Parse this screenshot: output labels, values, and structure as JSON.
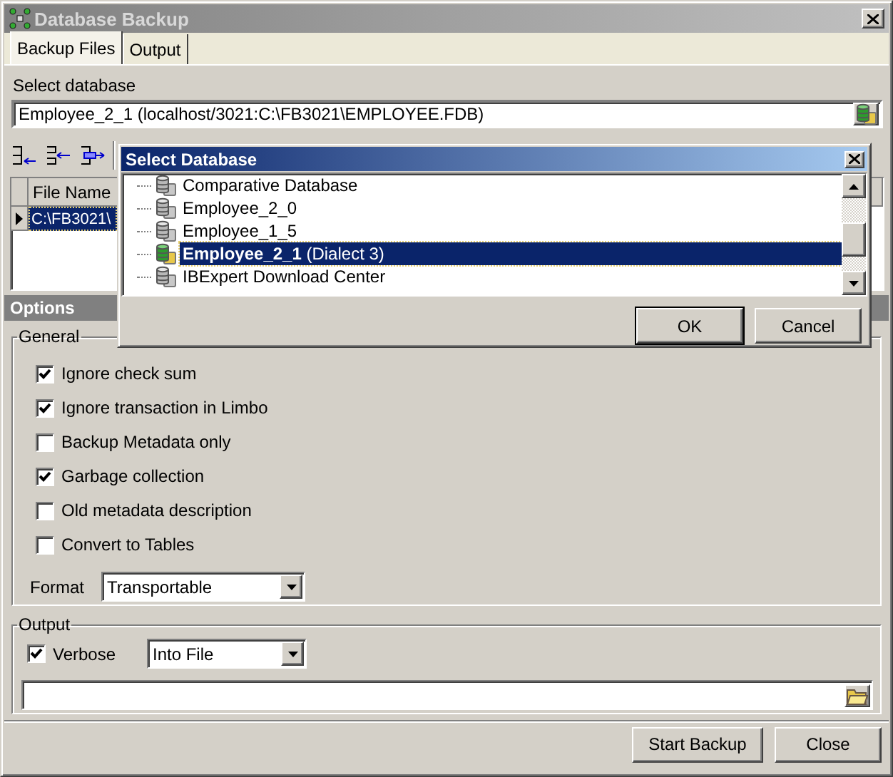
{
  "window": {
    "title": "Database Backup"
  },
  "tabs": [
    {
      "label": "Backup Files",
      "selected": true
    },
    {
      "label": "Output",
      "selected": false
    }
  ],
  "database": {
    "label": "Select database",
    "value": "Employee_2_1 (localhost/3021:C:\\FB3021\\EMPLOYEE.FDB)"
  },
  "files_grid": {
    "columns": [
      "File Name"
    ],
    "rows": [
      {
        "file_name": "C:\\FB3021\\",
        "selected": true
      }
    ]
  },
  "options": {
    "title": "Options",
    "general": {
      "title": "General",
      "checkboxes": [
        {
          "label": "Ignore check sum",
          "checked": true
        },
        {
          "label": "Ignore transaction in Limbo",
          "checked": true
        },
        {
          "label": "Backup Metadata only",
          "checked": false
        },
        {
          "label": "Garbage collection",
          "checked": true
        },
        {
          "label": "Old metadata description",
          "checked": false
        },
        {
          "label": "Convert to Tables",
          "checked": false
        }
      ],
      "format": {
        "label": "Format",
        "value": "Transportable"
      }
    },
    "output": {
      "title": "Output",
      "verbose": {
        "label": "Verbose",
        "checked": true
      },
      "target": "Into File"
    }
  },
  "buttons": [
    "Start Backup",
    "Close"
  ],
  "select_dialog": {
    "title": "Select Database",
    "items": [
      {
        "name": "Comparative Database",
        "connected": false,
        "selected": false
      },
      {
        "name": "Employee_2_0",
        "connected": false,
        "selected": false
      },
      {
        "name": "Employee_1_5",
        "connected": false,
        "selected": false
      },
      {
        "name": "Employee_2_1",
        "note": "(Dialect 3)",
        "connected": true,
        "selected": true
      },
      {
        "name": "IBExpert Download Center",
        "connected": false,
        "selected": false
      }
    ],
    "buttons": [
      "OK",
      "Cancel"
    ]
  }
}
